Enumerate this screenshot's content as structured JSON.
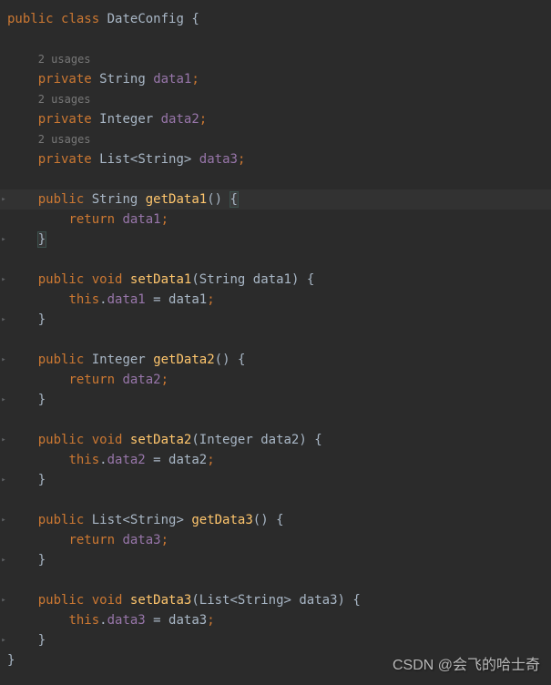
{
  "watermark": "CSDN @会飞的哈士奇",
  "hints": {
    "usages2": "2 usages"
  },
  "tokens": {
    "kw_public": "public",
    "kw_class": "class",
    "kw_private": "private",
    "kw_void": "void",
    "kw_return": "return",
    "kw_this": "this",
    "type_string": "String",
    "type_integer": "Integer",
    "type_list": "List",
    "cls_name": "DateConfig",
    "field_data1": "data1",
    "field_data2": "data2",
    "field_data3": "data3",
    "m_getData1": "getData1",
    "m_setData1": "setData1",
    "m_getData2": "getData2",
    "m_setData2": "setData2",
    "m_getData3": "getData3",
    "m_setData3": "setData3",
    "lbrace": "{",
    "rbrace": "}",
    "lparen": "(",
    "rparen": ")",
    "lt": "<",
    "gt": ">",
    "semi": ";",
    "comma": ",",
    "dot": ".",
    "eq": " = ",
    "space": " "
  }
}
